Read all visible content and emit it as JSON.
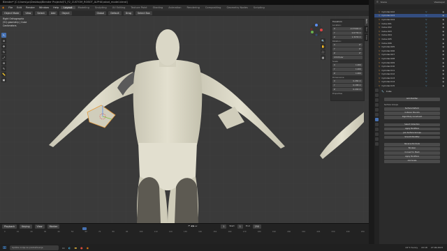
{
  "window_title": "Blender* [C:\\Users\\pc\\Desktop\\Blender Projects\\F1_F2_CUSTOM_ROBOT_ALPHA\\robot_model.blend]",
  "menu": [
    "File",
    "Edit",
    "Render",
    "Window",
    "Help"
  ],
  "workspaces": [
    "Layout",
    "Modeling",
    "Sculpting",
    "UV Editing",
    "Texture Paint",
    "Shading",
    "Animation",
    "Rendering",
    "Compositing",
    "Geometry Nodes",
    "Scripting"
  ],
  "active_workspace": "Layout",
  "scene_label": "Scene",
  "view_layer_label": "ViewLayer",
  "viewport_header": {
    "mode": "Object Mode",
    "view": "View",
    "select": "Select",
    "add": "Add",
    "object": "Object",
    "orientation": "Global",
    "snap": "Default",
    "drag": "Drag",
    "select_box": "Select Box"
  },
  "overlay_text": {
    "view_name": "Right Orthographic",
    "collection": "(51) geometry | Cube",
    "units": "Centimeters"
  },
  "npanel": {
    "title": "Transform",
    "location": {
      "label": "Location:",
      "x": "-0.37000 m",
      "y": "0.0739 m",
      "z": "1.3239 m"
    },
    "rotation": {
      "label": "Rotation:",
      "x": "0°",
      "y": "0°",
      "z": "0°"
    },
    "rotation_mode": "XYZ Euler",
    "scale": {
      "label": "Scale:",
      "x": "1.000",
      "y": "1.000",
      "z": "1.000"
    },
    "dimensions": {
      "label": "Dimensions:",
      "x": "0.284 m",
      "y": "0.188 m",
      "z": "0.200 m"
    },
    "properties": "Properties"
  },
  "npanel_tabs": [
    "Item",
    "Tool",
    "View"
  ],
  "timeline": {
    "playback": "Playback",
    "keying": "Keying",
    "view": "View",
    "marker": "Marker",
    "current_frame": "1",
    "start_label": "Start",
    "start": "1",
    "end_label": "End",
    "end": "250"
  },
  "timeline_ticks": [
    "0",
    "10",
    "20",
    "30",
    "40",
    "50",
    "60",
    "70",
    "80",
    "90",
    "100",
    "110",
    "120",
    "130",
    "140",
    "150",
    "160",
    "170",
    "180",
    "190",
    "200",
    "210",
    "220",
    "230",
    "240",
    "250"
  ],
  "outliner_items": [
    "Cylinder.022",
    "Cylinder.023",
    "Cylinder.024",
    "Cube.001",
    "Cube.002",
    "Cube.003",
    "Cube.004",
    "Cube.005",
    "Cube.006",
    "Cylinder.005",
    "Cylinder.006",
    "Cylinder.007",
    "Cylinder.008",
    "Cylinder.009",
    "Cylinder.010",
    "Cylinder.011",
    "Cylinder.012",
    "Cylinder.013",
    "Cylinder.014",
    "Cylinder.015",
    "Cylinder.016"
  ],
  "properties": {
    "object_name": "Cube",
    "modifier_label": "Add Modifier",
    "sections": [
      "Surface Deform",
      "Collision Bounds",
      "Rigid Body Constraint",
      "Select Collection",
      "Apply Modifiers",
      "Join Surface Groups",
      "Smooth Modifier",
      "Reverse Normals",
      "Boolean",
      "Convert to Mesh",
      "Apply Modifiers",
      "Add Scale"
    ],
    "surface_label": "Surface Groups"
  },
  "taskbar": {
    "search": "Upišite ovdje za pretraživanje",
    "weather": "24°C Sunny",
    "time": "22:18",
    "date": "27.06.2023"
  },
  "colors": {
    "accent": "#4772b3",
    "orange": "#e59b3d",
    "skin": "#d9d6c5",
    "viewport_bg": "#3a3a3a"
  }
}
